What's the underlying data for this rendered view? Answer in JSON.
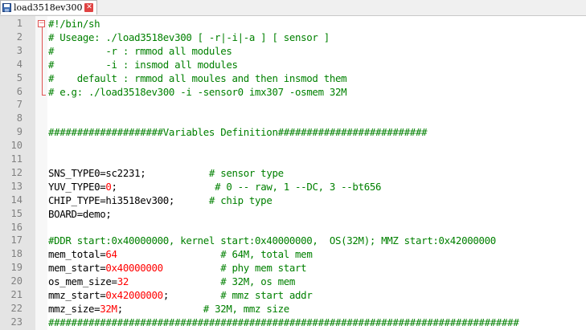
{
  "tab": {
    "label": "load3518ev300",
    "icon": "save-disk-icon",
    "close_icon": "close-icon",
    "close_glyph": "✕"
  },
  "lines": [
    {
      "n": "1",
      "segs": [
        {
          "t": "#!/bin/sh",
          "c": "comment"
        }
      ]
    },
    {
      "n": "2",
      "segs": [
        {
          "t": "# Useage: ./load3518ev300 [ -r|-i|-a ] [ sensor ]",
          "c": "comment"
        }
      ]
    },
    {
      "n": "3",
      "segs": [
        {
          "t": "#         -r : rmmod all modules",
          "c": "comment"
        }
      ]
    },
    {
      "n": "4",
      "segs": [
        {
          "t": "#         -i : insmod all modules",
          "c": "comment"
        }
      ]
    },
    {
      "n": "5",
      "segs": [
        {
          "t": "#    default : rmmod all moules and then insmod them",
          "c": "comment"
        }
      ]
    },
    {
      "n": "6",
      "segs": [
        {
          "t": "# e.g: ./load3518ev300 -i -sensor0 imx307 -osmem 32M",
          "c": "comment"
        }
      ]
    },
    {
      "n": "7",
      "segs": []
    },
    {
      "n": "8",
      "segs": []
    },
    {
      "n": "9",
      "segs": [
        {
          "t": "####################Variables Definition##########################",
          "c": "comment"
        }
      ]
    },
    {
      "n": "10",
      "segs": []
    },
    {
      "n": "11",
      "segs": []
    },
    {
      "n": "12",
      "segs": [
        {
          "t": "SNS_TYPE0=sc2231;           ",
          "c": "default"
        },
        {
          "t": "# sensor type",
          "c": "comment"
        }
      ]
    },
    {
      "n": "13",
      "segs": [
        {
          "t": "YUV_TYPE0=",
          "c": "default"
        },
        {
          "t": "0",
          "c": "num"
        },
        {
          "t": ";                 ",
          "c": "default"
        },
        {
          "t": "# 0 -- raw, 1 --DC, 3 --bt656",
          "c": "comment"
        }
      ]
    },
    {
      "n": "14",
      "segs": [
        {
          "t": "CHIP_TYPE=hi3518ev300;      ",
          "c": "default"
        },
        {
          "t": "# chip type",
          "c": "comment"
        }
      ]
    },
    {
      "n": "15",
      "segs": [
        {
          "t": "BOARD=demo;",
          "c": "default"
        }
      ]
    },
    {
      "n": "16",
      "segs": []
    },
    {
      "n": "17",
      "segs": [
        {
          "t": "#DDR start:0x40000000, kernel start:0x40000000,  OS(32M); MMZ start:0x42000000",
          "c": "comment"
        }
      ]
    },
    {
      "n": "18",
      "segs": [
        {
          "t": "mem_total=",
          "c": "default"
        },
        {
          "t": "64",
          "c": "num"
        },
        {
          "t": "                  ",
          "c": "default"
        },
        {
          "t": "# 64M, total mem",
          "c": "comment"
        }
      ]
    },
    {
      "n": "19",
      "segs": [
        {
          "t": "mem_start=",
          "c": "default"
        },
        {
          "t": "0x40000000",
          "c": "num"
        },
        {
          "t": "          ",
          "c": "default"
        },
        {
          "t": "# phy mem start",
          "c": "comment"
        }
      ]
    },
    {
      "n": "20",
      "segs": [
        {
          "t": "os_mem_size=",
          "c": "default"
        },
        {
          "t": "32",
          "c": "num"
        },
        {
          "t": "                ",
          "c": "default"
        },
        {
          "t": "# 32M, os mem",
          "c": "comment"
        }
      ]
    },
    {
      "n": "21",
      "segs": [
        {
          "t": "mmz_start=",
          "c": "default"
        },
        {
          "t": "0x42000000",
          "c": "num"
        },
        {
          "t": ";         ",
          "c": "default"
        },
        {
          "t": "# mmz start addr",
          "c": "comment"
        }
      ]
    },
    {
      "n": "22",
      "segs": [
        {
          "t": "mmz_size=",
          "c": "default"
        },
        {
          "t": "32M",
          "c": "num"
        },
        {
          "t": ";              ",
          "c": "default"
        },
        {
          "t": "# 32M, mmz size",
          "c": "comment"
        }
      ]
    },
    {
      "n": "23",
      "segs": [
        {
          "t": "##################################################################################",
          "c": "comment"
        }
      ]
    }
  ],
  "colors": {
    "comment": "#008000",
    "number": "#ff0000",
    "default": "#000000",
    "gutter": "#e4e4e4",
    "fold_marker": "#e05252"
  }
}
